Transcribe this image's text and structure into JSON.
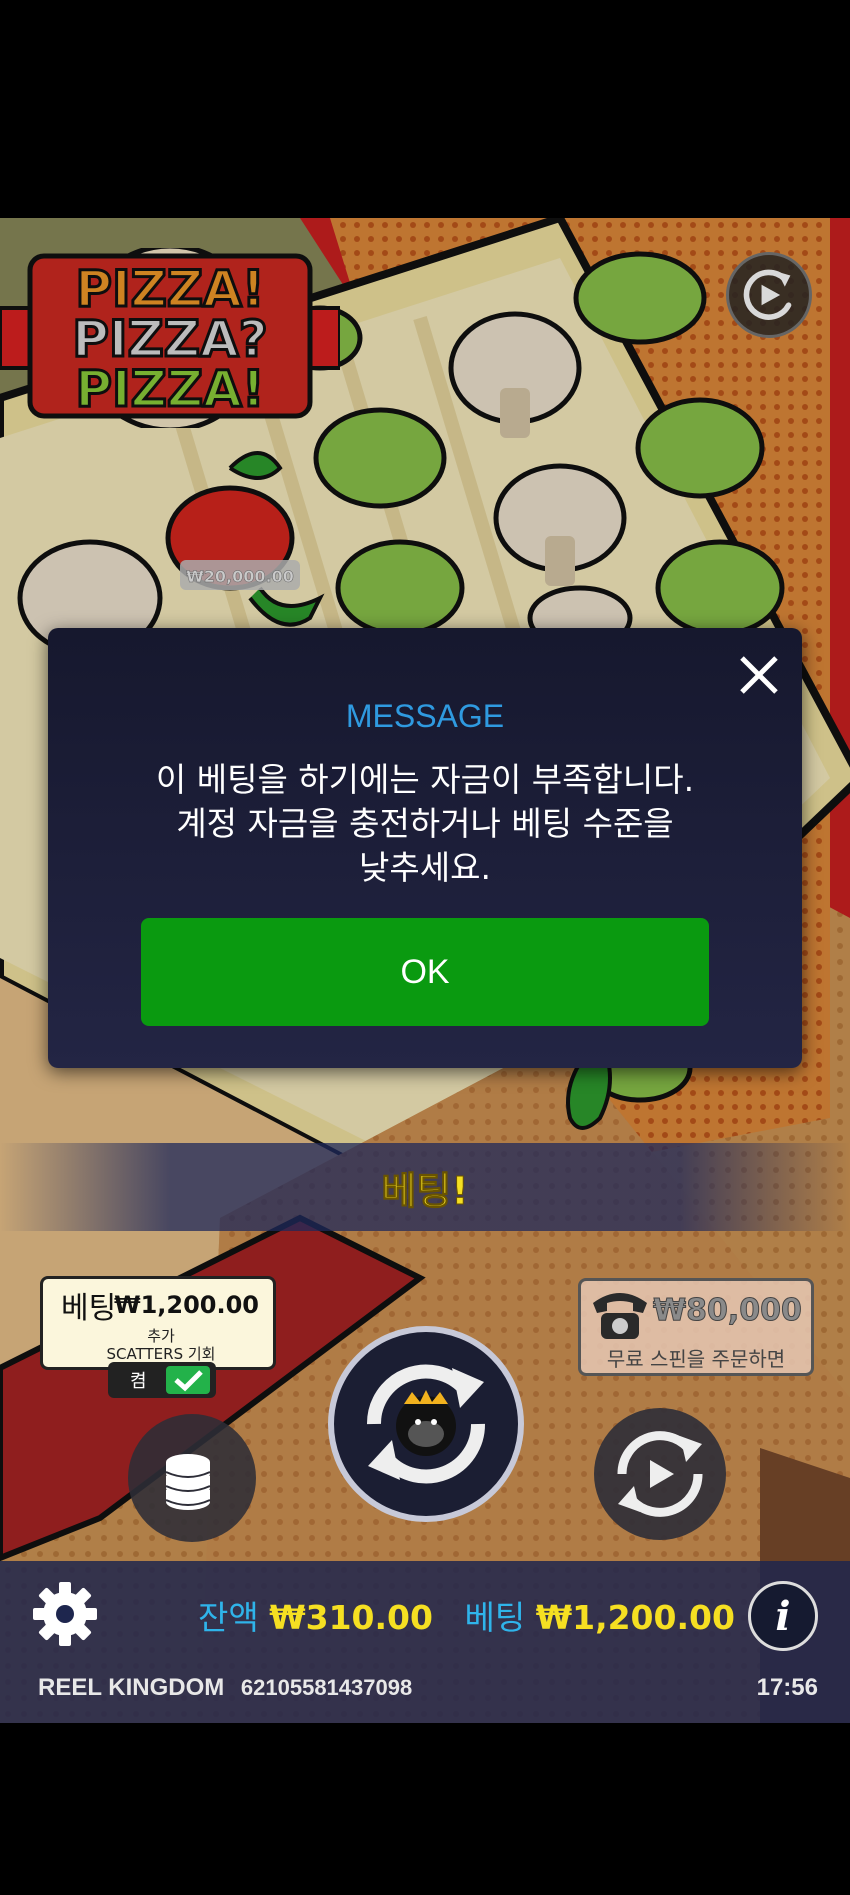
{
  "game": {
    "logo": {
      "line1": "PIZZA!",
      "line2": "PIZZA?",
      "line3": "PIZZA!"
    },
    "reel_prize_badge": "₩20,000.00"
  },
  "dialog": {
    "title": "MESSAGE",
    "line1": "이 베팅을 하기에는 자금이 부족합니다.",
    "line2": "계정 자금을 충전하거나 베팅 수준을",
    "line3": "낮추세요.",
    "ok_label": "OK"
  },
  "banner": {
    "text": "베팅!"
  },
  "scatter_bet": {
    "label": "베팅",
    "amount": "₩1,200.00",
    "line1": "추가",
    "line2": "SCATTERS 기회",
    "toggle_label": "켬"
  },
  "buy_feature": {
    "amount": "₩80,000",
    "text": "무료 스핀을 주문하면"
  },
  "status": {
    "balance_label": "잔액",
    "balance_value": "₩310.00",
    "bet_label": "베팅",
    "bet_value": "₩1,200.00",
    "provider": "REEL KINGDOM",
    "session_id": "62105581437098",
    "time": "17:56",
    "info_label": "i"
  },
  "icons": [
    "replay-icon",
    "close-icon",
    "check-icon",
    "coins-icon",
    "spin-icon",
    "autoplay-icon",
    "phone-icon",
    "gear-icon",
    "info-icon"
  ],
  "colors": {
    "accent_blue": "#2fb4ea",
    "value_yellow": "#f5df22",
    "ok_green": "#0a9a10",
    "dialog_bg": "#1a1c34"
  }
}
